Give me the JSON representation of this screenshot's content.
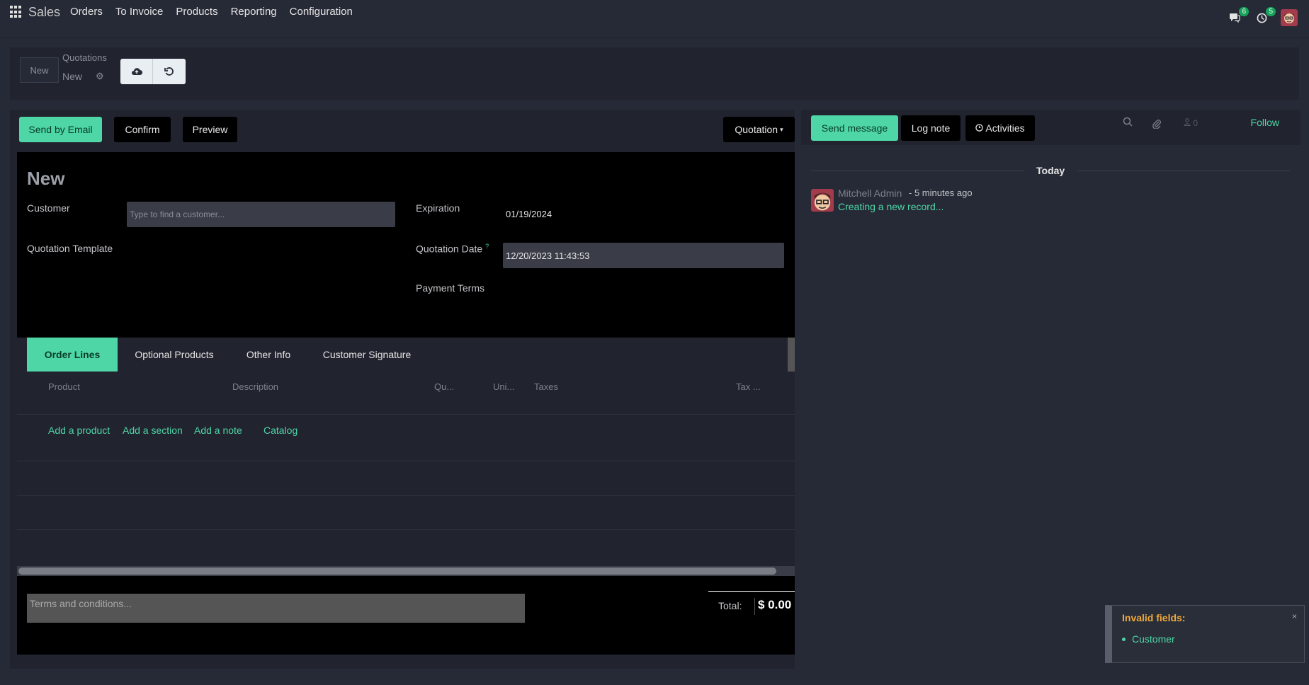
{
  "navbar": {
    "brand": "Sales",
    "menu": [
      "Orders",
      "To Invoice",
      "Products",
      "Reporting",
      "Configuration"
    ],
    "messages_badge": "6",
    "activities_badge": "5"
  },
  "control_panel": {
    "new_label": "New",
    "breadcrumb_parent": "Quotations",
    "breadcrumb_current": "New"
  },
  "statusbar": {
    "send_email": "Send by Email",
    "confirm": "Confirm",
    "preview": "Preview",
    "state": "Quotation"
  },
  "form": {
    "title": "New",
    "customer_label": "Customer",
    "customer_placeholder": "Type to find a customer...",
    "template_label": "Quotation Template",
    "expiration_label": "Expiration",
    "expiration_value": "01/19/2024",
    "quotation_date_label": "Quotation Date",
    "quotation_date_tip": "?",
    "quotation_date_value": "12/20/2023 11:43:53",
    "payment_terms_label": "Payment Terms"
  },
  "tabs": [
    "Order Lines",
    "Optional Products",
    "Other Info",
    "Customer Signature"
  ],
  "table": {
    "headers": [
      "Product",
      "Description",
      "Qu...",
      "Uni...",
      "Taxes",
      "Tax ..."
    ],
    "add_links": [
      "Add a product",
      "Add a section",
      "Add a note",
      "Catalog"
    ]
  },
  "footer": {
    "terms_placeholder": "Terms and conditions...",
    "total_label": "Total:",
    "total_value": "$ 0.00"
  },
  "chatter": {
    "send_message": "Send message",
    "log_note": "Log note",
    "activities": "Activities",
    "followers_count": "0",
    "follow": "Follow",
    "today": "Today",
    "message": {
      "author": "Mitchell Admin",
      "time": "- 5 minutes ago",
      "body": "Creating a new record..."
    }
  },
  "notification": {
    "title": "Invalid fields:",
    "close": "×",
    "items": [
      "Customer"
    ]
  },
  "colors": {
    "accent": "#4ed6a6",
    "background": "#262a36",
    "sheet": "#000000",
    "warning": "#f0a93b"
  }
}
